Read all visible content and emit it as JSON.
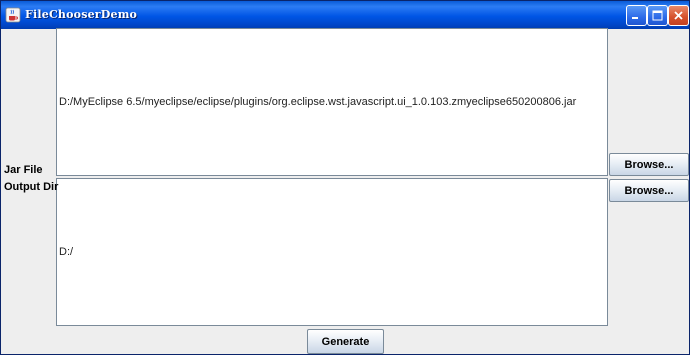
{
  "window": {
    "title": "FileChooserDemo",
    "icon": "java-coffee-cup-icon",
    "controls": [
      "minimize-icon",
      "maximize-icon",
      "close-icon"
    ]
  },
  "form": {
    "jar_label": "Jar File",
    "output_label": "Output Dir",
    "jar_value": "D:/MyEclipse 6.5/myeclipse/eclipse/plugins/org.eclipse.wst.javascript.ui_1.0.103.zmyeclipse650200806.jar",
    "output_value": "D:/",
    "browse_jar_label": "Browse...",
    "browse_output_label": "Browse...",
    "generate_label": "Generate"
  }
}
